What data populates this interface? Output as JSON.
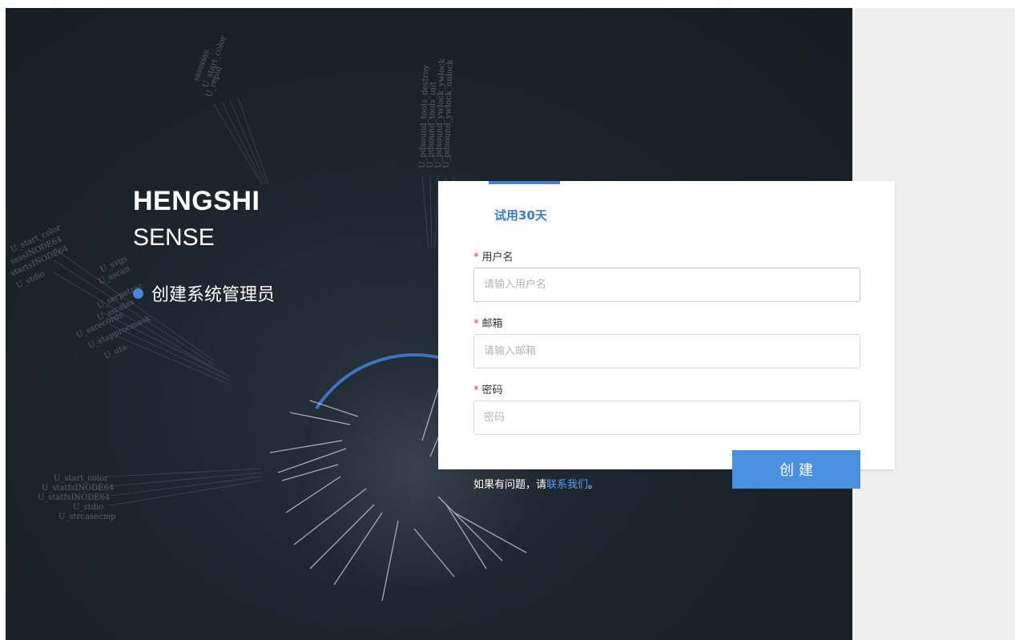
{
  "brand": {
    "title": "HENGSHI",
    "subtitle": "SENSE",
    "step_label": "创建系统管理员"
  },
  "form": {
    "tab_label": "试用30天",
    "username": {
      "label": "用户名",
      "required_mark": "*",
      "placeholder": "请输入用户名",
      "value": ""
    },
    "email": {
      "label": "邮箱",
      "required_mark": "*",
      "placeholder": "请输入邮箱",
      "value": ""
    },
    "password": {
      "label": "密码",
      "required_mark": "*",
      "placeholder": "密码",
      "value": ""
    },
    "submit_label": "创建"
  },
  "help": {
    "prefix": "如果有问题，请",
    "link_text": "联系我们",
    "suffix": "。"
  },
  "background_labels": {
    "top_left": [
      "U_start_color",
      "ssssssss",
      "U_repid"
    ],
    "top_center": [
      "U_pdsound_tools_destroy",
      "U_pdsound_tools_init",
      "U_pdsound_ywlock_ywlock",
      "U_pdsound_ywlock_unlock"
    ],
    "left_mid": [
      "U_start_color",
      "ssssINODE64",
      "startsINODE64",
      "U_stdio",
      "U_svgs",
      "U_sscan",
      "U_serpetrac",
      "U_sscalas",
      "U_sarecords",
      "U_stapprocmask",
      "U_uta"
    ],
    "left_bottom": [
      "U_start_color",
      "U_statfsINODE64",
      "U_statfsINODE64",
      "U_stdio",
      "U_strcasecmp"
    ]
  },
  "colors": {
    "accent": "#4a8fe0",
    "tab_accent": "#4a7fcd",
    "required": "#e03e3e",
    "hero_bg": "#1c242c",
    "side_bg": "#efefef"
  }
}
